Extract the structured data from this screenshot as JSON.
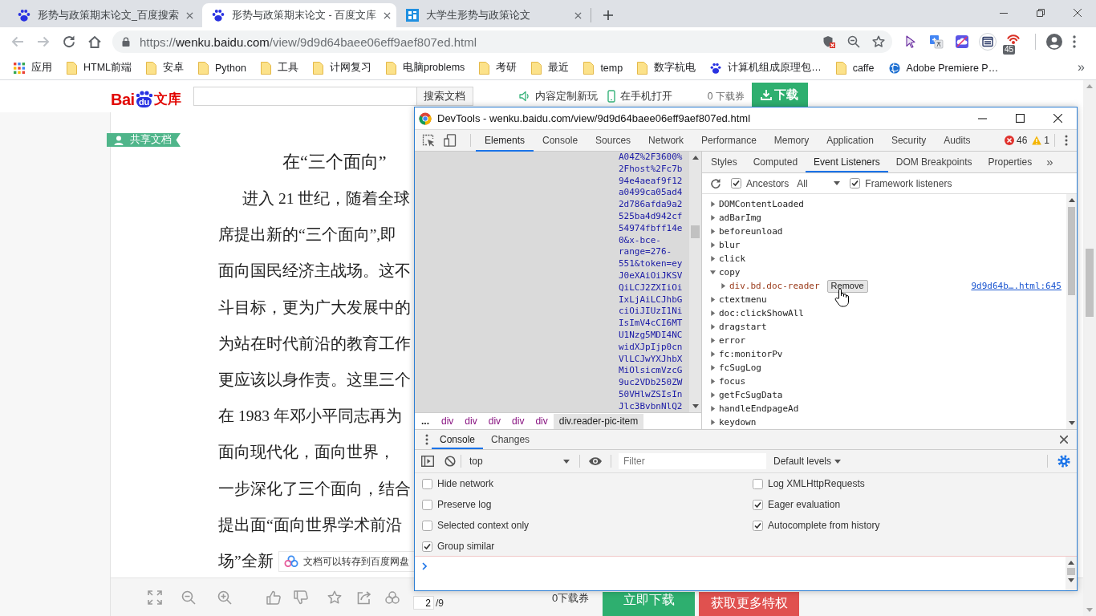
{
  "browser": {
    "tabs": [
      {
        "title": "形势与政策期末论文_百度搜索",
        "kind": "paw",
        "selected": false
      },
      {
        "title": "形势与政策期末论文 - 百度文库",
        "kind": "paw",
        "selected": true
      },
      {
        "title": "大学生形势与政策论文",
        "kind": "tile",
        "selected": false
      }
    ],
    "navigation": {
      "back_disabled": true,
      "forward_disabled": true
    },
    "address": {
      "scheme": "https://",
      "host": "wenku.baidu.com",
      "path": "/view/9d9d64baee06eff9aef807ed.html"
    },
    "extension_badge": "45",
    "bookmarks": [
      {
        "label": "应用",
        "kind": "apps"
      },
      {
        "label": "HTML前端",
        "kind": "folder"
      },
      {
        "label": "安卓",
        "kind": "folder"
      },
      {
        "label": "Python",
        "kind": "folder"
      },
      {
        "label": "工具",
        "kind": "folder"
      },
      {
        "label": "计网复习",
        "kind": "folder"
      },
      {
        "label": "电脑problems",
        "kind": "folder"
      },
      {
        "label": "考研",
        "kind": "folder"
      },
      {
        "label": "最近",
        "kind": "folder"
      },
      {
        "label": "temp",
        "kind": "folder"
      },
      {
        "label": "数字杭电",
        "kind": "folder"
      },
      {
        "label": "计算机组成原理包…",
        "kind": "paw"
      },
      {
        "label": "caffe",
        "kind": "folder"
      },
      {
        "label": "Adobe Premiere P…",
        "kind": "globe"
      }
    ],
    "bookmarks_overflow": "»"
  },
  "page": {
    "logo": {
      "left": "Bai",
      "paw": "du",
      "right": "文库"
    },
    "search_button": "搜索文档",
    "promo": "内容定制新玩",
    "open_on_phone": "在手机打开",
    "coupons": "0 下载券",
    "download_button": "下载",
    "share_tag": "共享文档",
    "document": {
      "title": "在“三个面向”",
      "lines": [
        {
          "text": "进入 21 世纪，随着全球",
          "indent": true
        },
        {
          "text": "席提出新的“三个面向”,即",
          "indent": false
        },
        {
          "text": "面向国民经济主战场。这不",
          "indent": false
        },
        {
          "text": "斗目标，更为广大发展中的",
          "indent": false
        },
        {
          "text": "为站在时代前沿的教育工作",
          "indent": false
        },
        {
          "text": "更应该以身作责。这里三个",
          "indent": false
        },
        {
          "text": "在 1983 年邓小平同志再为",
          "indent": false
        },
        {
          "text": "面向现代化，面向世界，",
          "indent": false
        },
        {
          "text": "一步深化了三个面向，结合",
          "indent": false
        },
        {
          "text": "提出面“面向世界学术前沿",
          "indent": false
        },
        {
          "text": "场”全新",
          "indent": false
        }
      ]
    },
    "toast": "文档可以转存到百度网盘",
    "toolbar": {
      "page": "2",
      "total": "/9",
      "coupons": "0下载券",
      "download_now": "立即下载",
      "vip": "获取更多特权"
    }
  },
  "devtools": {
    "title": "DevTools - wenku.baidu.com/view/9d9d64baee06eff9aef807ed.html",
    "tabs": [
      {
        "label": "Elements",
        "selected": true
      },
      {
        "label": "Console",
        "selected": false
      },
      {
        "label": "Sources",
        "selected": false
      },
      {
        "label": "Network",
        "selected": false
      },
      {
        "label": "Performance",
        "selected": false
      },
      {
        "label": "Memory",
        "selected": false
      },
      {
        "label": "Application",
        "selected": false
      },
      {
        "label": "Security",
        "selected": false
      },
      {
        "label": "Audits",
        "selected": false
      }
    ],
    "error_count": "46",
    "warning_count": "1",
    "dom_lines": [
      "A04Z%2F3600%",
      "2Fhost%2Fc7b",
      "94e4aeaf9f12",
      "a0499ca05ad4",
      "2d786afda9a2",
      "525ba4d942cf",
      "54974fbff14e",
      "0&x-bce-",
      "range=276-",
      "551&token=ey",
      "J0eXAiOiJKSV",
      "QiLCJ2ZXIiOi",
      "IxLjAiLCJhbG",
      "ciOiJIUzI1Ni",
      "IsImV4cCI6MT",
      "U1Nzg5MDI4NC",
      "widXJpIjp0cn",
      "VlLCJwYXJhbX",
      "MiOlsicmVzcG",
      "9uc2VDb250ZW",
      "50VHlwZSIsIn",
      "Jlc3BvbnNlQ2"
    ],
    "breadcrumbs": [
      {
        "label": "...",
        "kind": "ellipsis",
        "selected": false
      },
      {
        "label": "div",
        "kind": "node",
        "selected": false
      },
      {
        "label": "div",
        "kind": "node",
        "selected": false
      },
      {
        "label": "div",
        "kind": "node",
        "selected": false
      },
      {
        "label": "div",
        "kind": "node",
        "selected": false
      },
      {
        "label": "div",
        "kind": "node",
        "selected": false
      },
      {
        "label": "div.reader-pic-item",
        "kind": "node",
        "selected": true
      }
    ],
    "sidebar_tabs": [
      {
        "label": "Styles",
        "selected": false
      },
      {
        "label": "Computed",
        "selected": false
      },
      {
        "label": "Event Listeners",
        "selected": true
      },
      {
        "label": "DOM Breakpoints",
        "selected": false
      },
      {
        "label": "Properties",
        "selected": false
      }
    ],
    "sidebar_overflow": "»",
    "listener_filter": {
      "ancestors": {
        "label": "Ancestors",
        "checked": true
      },
      "scope": "All",
      "framework": {
        "label": "Framework listeners",
        "checked": true
      }
    },
    "events": [
      {
        "name": "DOMContentLoaded",
        "expanded": false
      },
      {
        "name": "adBarImg",
        "expanded": false
      },
      {
        "name": "beforeunload",
        "expanded": false
      },
      {
        "name": "blur",
        "expanded": false
      },
      {
        "name": "click",
        "expanded": false
      },
      {
        "name": "copy",
        "expanded": true,
        "children": [
          {
            "node": "div.bd.doc-reader",
            "expanded": false,
            "action": "Remove",
            "source": "9d9d64b….html:645"
          }
        ]
      },
      {
        "name": "ctextmenu",
        "expanded": false
      },
      {
        "name": "doc:clickShowAll",
        "expanded": false
      },
      {
        "name": "dragstart",
        "expanded": false
      },
      {
        "name": "error",
        "expanded": false
      },
      {
        "name": "fc:monitorPv",
        "expanded": false
      },
      {
        "name": "fcSugLog",
        "expanded": false
      },
      {
        "name": "focus",
        "expanded": false
      },
      {
        "name": "getFcSugData",
        "expanded": false
      },
      {
        "name": "handleEndpageAd",
        "expanded": false
      },
      {
        "name": "keydown",
        "expanded": false
      }
    ],
    "drawer": {
      "tabs": [
        {
          "label": "Console",
          "selected": true
        },
        {
          "label": "Changes",
          "selected": false
        }
      ],
      "context": "top",
      "filter_placeholder": "Filter",
      "levels": "Default levels",
      "settings_left": [
        {
          "label": "Hide network",
          "checked": false
        },
        {
          "label": "Preserve log",
          "checked": false
        },
        {
          "label": "Selected context only",
          "checked": false
        },
        {
          "label": "Group similar",
          "checked": true
        }
      ],
      "settings_right": [
        {
          "label": "Log XMLHttpRequests",
          "checked": false
        },
        {
          "label": "Eager evaluation",
          "checked": true
        },
        {
          "label": "Autocomplete from history",
          "checked": true
        }
      ]
    }
  }
}
